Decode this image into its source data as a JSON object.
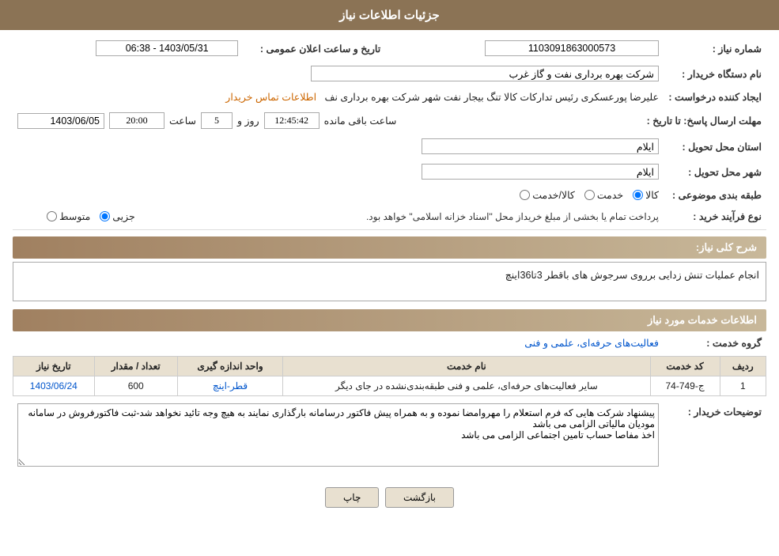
{
  "header": {
    "title": "جزئیات اطلاعات نیاز"
  },
  "fields": {
    "shomareNiaz_label": "شماره نیاز :",
    "shomareNiaz_value": "1103091863000573",
    "namDastgah_label": "نام دستگاه خریدار :",
    "namDastgah_value": "شرکت بهره برداری نفت و گاز غرب",
    "ijadKonande_label": "ایجاد کننده درخواست :",
    "ijadKonande_value": "علیرضا پورعسکری رئیس تدارکات کالا تنگ بیجار نفت شهر شرکت بهره برداری نف",
    "ijadKonande_link": "اطلاعات تماس خریدار",
    "mohlatErsal_label": "مهلت ارسال پاسخ: تا تاریخ :",
    "tarikhElan_label": "تاریخ و ساعت اعلان عمومی :",
    "tarikhElan_value": "1403/05/31 - 06:38",
    "tarikheElan_date": "1403/06/05",
    "saat": "20:00",
    "rooz": "5",
    "baghimande": "12:45:42",
    "ostanTahvil_label": "استان محل تحویل :",
    "ostanTahvil_value": "ایلام",
    "shahrTahvil_label": "شهر محل تحویل :",
    "shahrTahvil_value": "ایلام",
    "tabaqeBandi_label": "طبقه بندی موضوعی :",
    "radio_kala": "کالا",
    "radio_khadamat": "خدمت",
    "radio_kalaKhadamat": "کالا/خدمت",
    "noeFarayand_label": "نوع فرآیند خرید :",
    "radio_jozee": "جزیی",
    "radio_motavaset": "متوسط",
    "noeFarayand_desc": "پرداخت تمام یا بخشی از مبلغ خریداز محل \"اسناد خزانه اسلامی\" خواهد بود.",
    "sharhKolly_label": "شرح کلی نیاز:",
    "sharhKolly_value": "انجام عملیات تنش زدایی برروی سرجوش های باقطر 3تا36اینچ",
    "section2_title": "اطلاعات خدمات مورد نیاز",
    "groheKhadamat_label": "گروه خدمت :",
    "groheKhadamat_value": "فعالیت‌های حرفه‌ای، علمی و فنی",
    "table": {
      "headers": [
        "ردیف",
        "کد خدمت",
        "نام خدمت",
        "واحد اندازه گیری",
        "تعداد / مقدار",
        "تاریخ نیاز"
      ],
      "rows": [
        {
          "radif": "1",
          "kodKhadamat": "ج-749-74",
          "namKhadamat": "سایر فعالیت‌های حرفه‌ای، علمی و فنی طبقه‌بندی‌نشده در جای دیگر",
          "vahed": "قطر-اینچ",
          "tedad": "600",
          "tarikh": "1403/06/24"
        }
      ]
    },
    "توضیحات_label": "توضیحات خریدار :",
    "توضیحات_value": "پیشنهاد شرکت هایی که فرم استعلام را مهروامضا نموده و به همراه پیش فاکتور درسامانه بارگذاری نمایند به هیچ وجه تائید نخواهد شد-ثبت فاکتورفروش در سامانه مودیان مالیاتی الزامی می باشد\nاخذ مفاصا حساب تامین اجتماعی الزامی می باشد"
  },
  "buttons": {
    "print": "چاپ",
    "back": "بازگشت"
  }
}
